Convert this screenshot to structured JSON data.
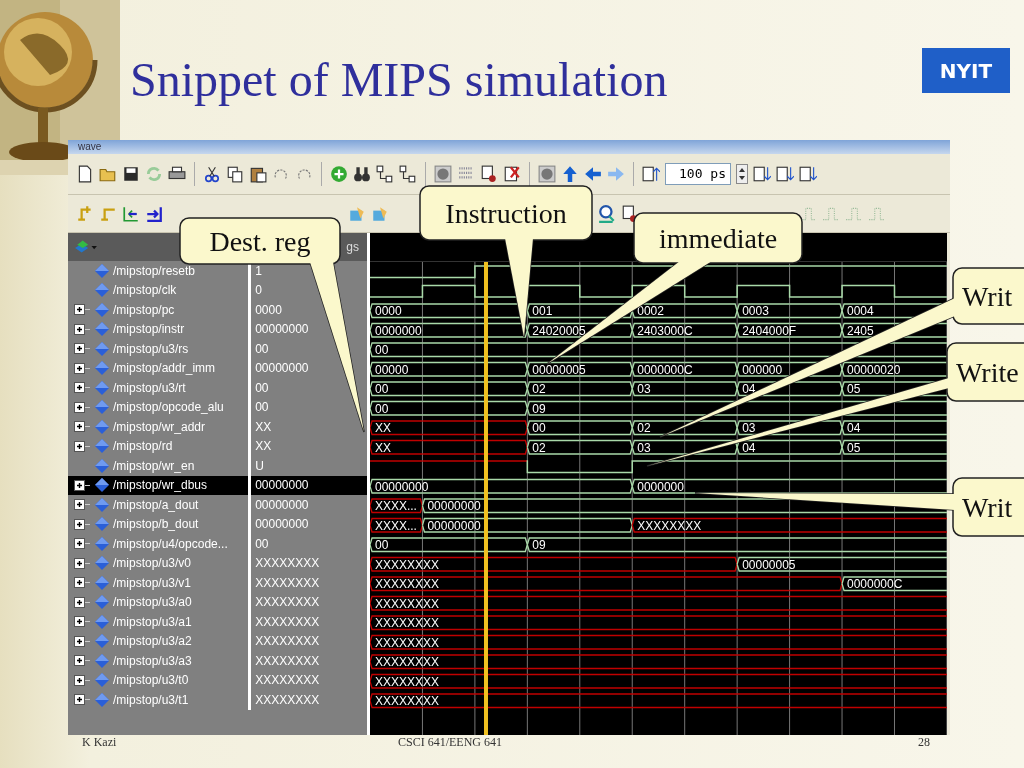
{
  "slide": {
    "title": "Snippet of MIPS simulation",
    "logo": "NYIT",
    "footer": {
      "author": "K Kazi",
      "course": "CSCI 641/EENG 641",
      "page": "28"
    }
  },
  "window": {
    "title": "wave"
  },
  "toolbar": {
    "time_value": "100 ps"
  },
  "wave_panel": {
    "header_label": "gs"
  },
  "signals": [
    {
      "name": "/mipstop/resetb",
      "value": "1",
      "expandable": false,
      "selected": false,
      "kind": "bit",
      "cells": [
        {
          "high": false,
          "unknown": false
        },
        {
          "high": false,
          "unknown": false
        },
        {
          "high": true,
          "unknown": false
        },
        {
          "high": true,
          "unknown": false
        },
        {
          "high": true,
          "unknown": false
        },
        {
          "high": true,
          "unknown": false
        },
        {
          "high": true,
          "unknown": false
        },
        {
          "high": true,
          "unknown": false
        },
        {
          "high": true,
          "unknown": false
        },
        {
          "high": true,
          "unknown": false
        },
        {
          "high": true,
          "unknown": false
        }
      ]
    },
    {
      "name": "/mipstop/clk",
      "value": "0",
      "expandable": false,
      "selected": false,
      "kind": "bit",
      "cells": [
        {
          "high": false,
          "unknown": false
        },
        {
          "high": true,
          "unknown": false
        },
        {
          "high": false,
          "unknown": false
        },
        {
          "high": true,
          "unknown": false
        },
        {
          "high": false,
          "unknown": false
        },
        {
          "high": true,
          "unknown": false
        },
        {
          "high": false,
          "unknown": false
        },
        {
          "high": true,
          "unknown": false
        },
        {
          "high": false,
          "unknown": false
        },
        {
          "high": true,
          "unknown": false
        },
        {
          "high": false,
          "unknown": false
        }
      ]
    },
    {
      "name": "/mipstop/pc",
      "value": "0000",
      "expandable": true,
      "selected": false,
      "kind": "bus",
      "cells": [
        {
          "unknown": false,
          "value": "0000"
        },
        {
          "unknown": false
        },
        {
          "unknown": false
        },
        {
          "unknown": false,
          "value": "001"
        },
        {
          "unknown": false
        },
        {
          "unknown": false,
          "value": "0002"
        },
        {
          "unknown": false
        },
        {
          "unknown": false,
          "value": "0003"
        },
        {
          "unknown": false
        },
        {
          "unknown": false,
          "value": "0004"
        },
        {
          "unknown": false
        }
      ]
    },
    {
      "name": "/mipstop/instr",
      "value": "00000000",
      "expandable": true,
      "selected": false,
      "kind": "bus",
      "cells": [
        {
          "unknown": false,
          "value": "0000000"
        },
        {
          "unknown": false
        },
        {
          "unknown": false
        },
        {
          "unknown": false,
          "value": "24020005"
        },
        {
          "unknown": false
        },
        {
          "unknown": false,
          "value": "2403000C"
        },
        {
          "unknown": false
        },
        {
          "unknown": false,
          "value": "2404000F"
        },
        {
          "unknown": false
        },
        {
          "unknown": false,
          "value": "2405"
        },
        {
          "unknown": false
        }
      ]
    },
    {
      "name": "/mipstop/u3/rs",
      "value": "00",
      "expandable": true,
      "selected": false,
      "kind": "bus",
      "cells": [
        {
          "unknown": false,
          "value": "00"
        },
        {
          "unknown": false
        },
        {
          "unknown": false
        },
        {
          "unknown": false
        },
        {
          "unknown": false
        },
        {
          "unknown": false
        },
        {
          "unknown": false
        },
        {
          "unknown": false
        },
        {
          "unknown": false
        },
        {
          "unknown": false
        },
        {
          "unknown": false
        }
      ]
    },
    {
      "name": "/mipstop/addr_imm",
      "value": "00000000",
      "expandable": true,
      "selected": false,
      "kind": "bus",
      "cells": [
        {
          "unknown": false,
          "value": "00000"
        },
        {
          "unknown": false
        },
        {
          "unknown": false
        },
        {
          "unknown": false,
          "value": "00000005"
        },
        {
          "unknown": false
        },
        {
          "unknown": false,
          "value": "0000000C"
        },
        {
          "unknown": false
        },
        {
          "unknown": false,
          "value": "000000"
        },
        {
          "unknown": false
        },
        {
          "unknown": false,
          "value": "00000020"
        },
        {
          "unknown": false
        }
      ]
    },
    {
      "name": "/mipstop/u3/rt",
      "value": "00",
      "expandable": true,
      "selected": false,
      "kind": "bus",
      "cells": [
        {
          "unknown": false,
          "value": "00"
        },
        {
          "unknown": false
        },
        {
          "unknown": false
        },
        {
          "unknown": false,
          "value": "02"
        },
        {
          "unknown": false
        },
        {
          "unknown": false,
          "value": "03"
        },
        {
          "unknown": false
        },
        {
          "unknown": false,
          "value": "04"
        },
        {
          "unknown": false
        },
        {
          "unknown": false,
          "value": "05"
        },
        {
          "unknown": false
        }
      ]
    },
    {
      "name": "/mipstop/opcode_alu",
      "value": "00",
      "expandable": true,
      "selected": false,
      "kind": "bus",
      "cells": [
        {
          "unknown": false,
          "value": "00"
        },
        {
          "unknown": false
        },
        {
          "unknown": false
        },
        {
          "unknown": false,
          "value": "09"
        },
        {
          "unknown": false
        },
        {
          "unknown": false
        },
        {
          "unknown": false
        },
        {
          "unknown": false
        },
        {
          "unknown": false
        },
        {
          "unknown": false
        },
        {
          "unknown": false
        }
      ]
    },
    {
      "name": "/mipstop/wr_addr",
      "value": "XX",
      "expandable": true,
      "selected": false,
      "kind": "bus",
      "cells": [
        {
          "unknown": true,
          "value": "XX"
        },
        {
          "unknown": true
        },
        {
          "unknown": true
        },
        {
          "unknown": false,
          "value": "00"
        },
        {
          "unknown": false
        },
        {
          "unknown": false,
          "value": "02"
        },
        {
          "unknown": false
        },
        {
          "unknown": false,
          "value": "03"
        },
        {
          "unknown": false
        },
        {
          "unknown": false,
          "value": "04"
        },
        {
          "unknown": false
        }
      ]
    },
    {
      "name": "/mipstop/rd",
      "value": "XX",
      "expandable": true,
      "selected": false,
      "kind": "bus",
      "cells": [
        {
          "unknown": true,
          "value": "XX"
        },
        {
          "unknown": true
        },
        {
          "unknown": true
        },
        {
          "unknown": false,
          "value": "02"
        },
        {
          "unknown": false
        },
        {
          "unknown": false,
          "value": "03"
        },
        {
          "unknown": false
        },
        {
          "unknown": false,
          "value": "04"
        },
        {
          "unknown": false
        },
        {
          "unknown": false,
          "value": "05"
        },
        {
          "unknown": false
        }
      ]
    },
    {
      "name": "/mipstop/wr_en",
      "value": "U",
      "expandable": false,
      "selected": false,
      "kind": "bit",
      "cells": [
        {
          "high": true,
          "unknown": true
        },
        {
          "high": true,
          "unknown": true
        },
        {
          "high": true,
          "unknown": true
        },
        {
          "high": false,
          "unknown": false
        },
        {
          "high": false,
          "unknown": false
        },
        {
          "high": true,
          "unknown": false
        },
        {
          "high": true,
          "unknown": false
        },
        {
          "high": true,
          "unknown": false
        },
        {
          "high": true,
          "unknown": false
        },
        {
          "high": true,
          "unknown": false
        },
        {
          "high": true,
          "unknown": false
        }
      ]
    },
    {
      "name": "/mipstop/wr_dbus",
      "value": "00000000",
      "expandable": true,
      "selected": true,
      "kind": "bus",
      "cells": [
        {
          "unknown": false,
          "value": "00000000"
        },
        {
          "unknown": false
        },
        {
          "unknown": false
        },
        {
          "unknown": false
        },
        {
          "unknown": false
        },
        {
          "unknown": false,
          "value": "0000000"
        },
        {
          "unknown": false
        },
        {
          "unknown": false
        },
        {
          "unknown": false
        },
        {
          "unknown": false
        },
        {
          "unknown": false
        }
      ]
    },
    {
      "name": "/mipstop/a_dout",
      "value": "00000000",
      "expandable": true,
      "selected": false,
      "kind": "bus",
      "cells": [
        {
          "unknown": true,
          "value": "XXXX..."
        },
        {
          "unknown": false,
          "value": "00000000"
        },
        {
          "unknown": false
        },
        {
          "unknown": false
        },
        {
          "unknown": false
        },
        {
          "unknown": false
        },
        {
          "unknown": false
        },
        {
          "unknown": false
        },
        {
          "unknown": false
        },
        {
          "unknown": false
        },
        {
          "unknown": false
        }
      ]
    },
    {
      "name": "/mipstop/b_dout",
      "value": "00000000",
      "expandable": true,
      "selected": false,
      "kind": "bus",
      "cells": [
        {
          "unknown": true,
          "value": "XXXX..."
        },
        {
          "unknown": false,
          "value": "00000000"
        },
        {
          "unknown": false
        },
        {
          "unknown": false
        },
        {
          "unknown": false
        },
        {
          "unknown": true,
          "value": "XXXXXXXX"
        },
        {
          "unknown": true
        },
        {
          "unknown": true
        },
        {
          "unknown": true
        },
        {
          "unknown": true
        },
        {
          "unknown": true
        }
      ]
    },
    {
      "name": "/mipstop/u4/opcode...",
      "value": "00",
      "expandable": true,
      "selected": false,
      "kind": "bus",
      "cells": [
        {
          "unknown": false,
          "value": "00"
        },
        {
          "unknown": false
        },
        {
          "unknown": false
        },
        {
          "unknown": false,
          "value": "09"
        },
        {
          "unknown": false
        },
        {
          "unknown": false
        },
        {
          "unknown": false
        },
        {
          "unknown": false
        },
        {
          "unknown": false
        },
        {
          "unknown": false
        },
        {
          "unknown": false
        }
      ]
    },
    {
      "name": "/mipstop/u3/v0",
      "value": "XXXXXXXX",
      "expandable": true,
      "selected": false,
      "kind": "bus",
      "cells": [
        {
          "unknown": true,
          "value": "XXXXXXXX"
        },
        {
          "unknown": true
        },
        {
          "unknown": true
        },
        {
          "unknown": true
        },
        {
          "unknown": true
        },
        {
          "unknown": true
        },
        {
          "unknown": true
        },
        {
          "unknown": false,
          "value": "00000005"
        },
        {
          "unknown": false
        },
        {
          "unknown": false
        },
        {
          "unknown": false
        }
      ]
    },
    {
      "name": "/mipstop/u3/v1",
      "value": "XXXXXXXX",
      "expandable": true,
      "selected": false,
      "kind": "bus",
      "cells": [
        {
          "unknown": true,
          "value": "XXXXXXXX"
        },
        {
          "unknown": true
        },
        {
          "unknown": true
        },
        {
          "unknown": true
        },
        {
          "unknown": true
        },
        {
          "unknown": true
        },
        {
          "unknown": true
        },
        {
          "unknown": true
        },
        {
          "unknown": true
        },
        {
          "unknown": false,
          "value": "0000000C"
        },
        {
          "unknown": false
        }
      ]
    },
    {
      "name": "/mipstop/u3/a0",
      "value": "XXXXXXXX",
      "expandable": true,
      "selected": false,
      "kind": "bus",
      "cells": [
        {
          "unknown": true,
          "value": "XXXXXXXX"
        },
        {
          "unknown": true
        },
        {
          "unknown": true
        },
        {
          "unknown": true
        },
        {
          "unknown": true
        },
        {
          "unknown": true
        },
        {
          "unknown": true
        },
        {
          "unknown": true
        },
        {
          "unknown": true
        },
        {
          "unknown": true
        },
        {
          "unknown": true
        }
      ]
    },
    {
      "name": "/mipstop/u3/a1",
      "value": "XXXXXXXX",
      "expandable": true,
      "selected": false,
      "kind": "bus",
      "cells": [
        {
          "unknown": true,
          "value": "XXXXXXXX"
        },
        {
          "unknown": true
        },
        {
          "unknown": true
        },
        {
          "unknown": true
        },
        {
          "unknown": true
        },
        {
          "unknown": true
        },
        {
          "unknown": true
        },
        {
          "unknown": true
        },
        {
          "unknown": true
        },
        {
          "unknown": true
        },
        {
          "unknown": true
        }
      ]
    },
    {
      "name": "/mipstop/u3/a2",
      "value": "XXXXXXXX",
      "expandable": true,
      "selected": false,
      "kind": "bus",
      "cells": [
        {
          "unknown": true,
          "value": "XXXXXXXX"
        },
        {
          "unknown": true
        },
        {
          "unknown": true
        },
        {
          "unknown": true
        },
        {
          "unknown": true
        },
        {
          "unknown": true
        },
        {
          "unknown": true
        },
        {
          "unknown": true
        },
        {
          "unknown": true
        },
        {
          "unknown": true
        },
        {
          "unknown": true
        }
      ]
    },
    {
      "name": "/mipstop/u3/a3",
      "value": "XXXXXXXX",
      "expandable": true,
      "selected": false,
      "kind": "bus",
      "cells": [
        {
          "unknown": true,
          "value": "XXXXXXXX"
        },
        {
          "unknown": true
        },
        {
          "unknown": true
        },
        {
          "unknown": true
        },
        {
          "unknown": true
        },
        {
          "unknown": true
        },
        {
          "unknown": true
        },
        {
          "unknown": true
        },
        {
          "unknown": true
        },
        {
          "unknown": true
        },
        {
          "unknown": true
        }
      ]
    },
    {
      "name": "/mipstop/u3/t0",
      "value": "XXXXXXXX",
      "expandable": true,
      "selected": false,
      "kind": "bus",
      "cells": [
        {
          "unknown": true,
          "value": "XXXXXXXX"
        },
        {
          "unknown": true
        },
        {
          "unknown": true
        },
        {
          "unknown": true
        },
        {
          "unknown": true
        },
        {
          "unknown": true
        },
        {
          "unknown": true
        },
        {
          "unknown": true
        },
        {
          "unknown": true
        },
        {
          "unknown": true
        },
        {
          "unknown": true
        }
      ]
    },
    {
      "name": "/mipstop/u3/t1",
      "value": "XXXXXXXX",
      "expandable": true,
      "selected": false,
      "kind": "bus",
      "cells": [
        {
          "unknown": true,
          "value": "XXXXXXXX"
        },
        {
          "unknown": true
        },
        {
          "unknown": true
        },
        {
          "unknown": true
        },
        {
          "unknown": true
        },
        {
          "unknown": true
        },
        {
          "unknown": true
        },
        {
          "unknown": true
        },
        {
          "unknown": true
        },
        {
          "unknown": true
        },
        {
          "unknown": true
        }
      ]
    }
  ],
  "callouts": [
    {
      "text": "Dest. reg"
    },
    {
      "text": "Instruction"
    },
    {
      "text": "immediate"
    },
    {
      "text": "Writ"
    },
    {
      "text": "Write"
    },
    {
      "text": "Writ"
    }
  ]
}
